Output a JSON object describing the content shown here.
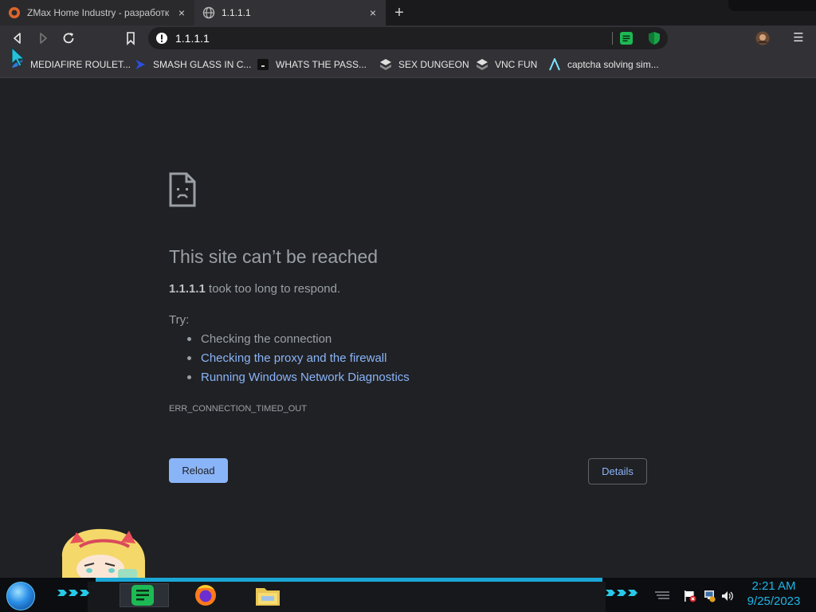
{
  "tabs": [
    {
      "title": "ZMax Home Industry - разработк",
      "close": "×"
    },
    {
      "title": "1.1.1.1",
      "close": "×"
    }
  ],
  "new_tab": "+",
  "omnibox": {
    "url": "1.1.1.1"
  },
  "menu": "☰",
  "bookmarks": [
    {
      "label": "MEDIAFIRE ROULET..."
    },
    {
      "label": "SMASH GLASS IN C..."
    },
    {
      "label": "WHATS THE PASS..."
    },
    {
      "label": "SEX DUNGEON"
    },
    {
      "label": "VNC FUN"
    },
    {
      "label": "captcha solving sim..."
    }
  ],
  "error": {
    "title": "This site can’t be reached",
    "host": "1.1.1.1",
    "desc_rest": " took too long to respond.",
    "try_label": "Try:",
    "suggestions": [
      "Checking the connection",
      "Checking the proxy and the firewall",
      "Running Windows Network Diagnostics"
    ],
    "code": "ERR_CONNECTION_TIMED_OUT",
    "reload_label": "Reload",
    "details_label": "Details"
  },
  "taskbar": {
    "clock_time": "2:21 AM",
    "clock_date": "9/25/2023"
  },
  "colors": {
    "page_bg": "#202124",
    "link": "#8ab4f8",
    "text_muted": "#9aa0a6",
    "clock": "#1fb5e6"
  }
}
